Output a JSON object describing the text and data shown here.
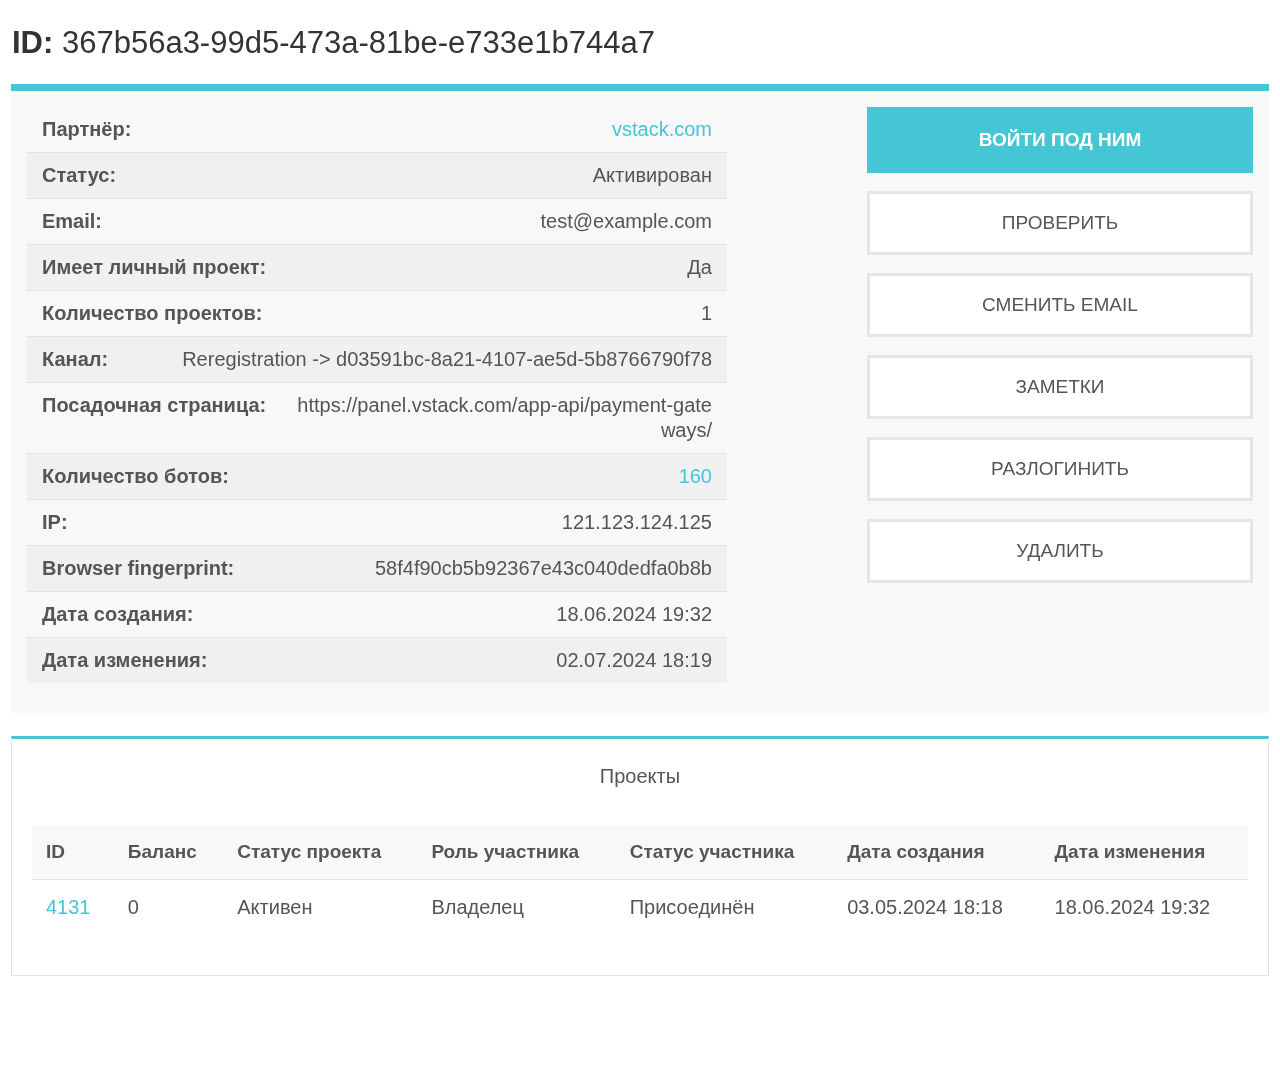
{
  "title": "**ID:** 367b56a3-99d5-473a-81be-e733e1b744a7",
  "details": [
    {
      "label": "Партнёр:",
      "value": "vstack.com",
      "kind": "link"
    },
    {
      "label": "Статус:",
      "value": "Активирован",
      "kind": "text"
    },
    {
      "label": "Email:",
      "value": "test@example.com",
      "kind": "text"
    },
    {
      "label": "Имеет личный проект:",
      "value": "Да",
      "kind": "text"
    },
    {
      "label": "Количество проектов:",
      "value": "1",
      "kind": "text"
    },
    {
      "label": "Канал:",
      "value": "Reregistration -> d03591bc-8a21-4107-ae5d-5b8766790f78",
      "kind": "text"
    },
    {
      "label": "Посадочная страница:",
      "value": "https://panel.vstack.com/app-api/payment-gateways/",
      "kind": "text"
    },
    {
      "label": "Количество ботов:",
      "value": "160",
      "kind": "link"
    },
    {
      "label": "IP:",
      "value": "121.123.124.125",
      "kind": "text"
    },
    {
      "label": "Browser fingerprint:",
      "value": "58f4f90cb5b92367e43c040dedfa0b8b",
      "kind": "text"
    },
    {
      "label": "Дата создания:",
      "value": "18.06.2024 19:32",
      "kind": "text"
    },
    {
      "label": "Дата изменения:",
      "value": "02.07.2024 18:19",
      "kind": "text"
    }
  ],
  "actions": [
    {
      "label": "ВОЙТИ ПОД НИМ",
      "kind": "primary"
    },
    {
      "label": "ПРОВЕРИТЬ",
      "kind": "outline"
    },
    {
      "label": "СМЕНИТЬ EMAIL",
      "kind": "outline"
    },
    {
      "label": "ЗАМЕТКИ",
      "kind": "outline"
    },
    {
      "label": "РАЗЛОГИНИТЬ",
      "kind": "outline"
    },
    {
      "label": "УДАЛИТЬ",
      "kind": "outline"
    }
  ],
  "projects": {
    "title": "Проекты",
    "columns": [
      "ID",
      "Баланс",
      "Статус проекта",
      "Роль участника",
      "Статус участника",
      "Дата создания",
      "Дата изменения"
    ],
    "rows": [
      [
        "4131",
        "0",
        "Активен",
        "Владелец",
        "Присоединён",
        "03.05.2024 18:18",
        "18.06.2024 19:32"
      ]
    ]
  }
}
